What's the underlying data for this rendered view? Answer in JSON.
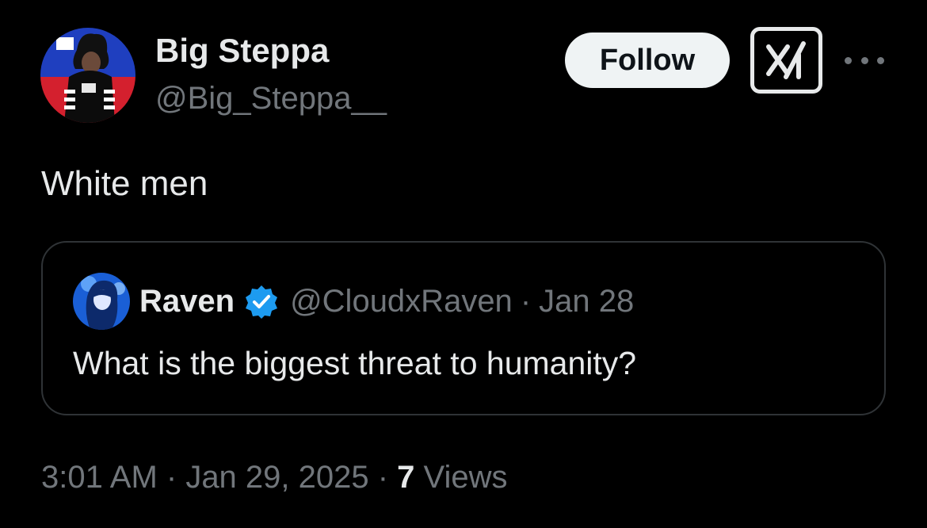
{
  "author": {
    "display_name": "Big Steppa",
    "handle": "@Big_Steppa__",
    "avatar_icon": "profile-avatar"
  },
  "actions": {
    "follow_label": "Follow",
    "grok_icon": "grok-icon",
    "more_icon": "more-horizontal-icon"
  },
  "tweet": {
    "text": "White men"
  },
  "quoted": {
    "display_name": "Raven",
    "handle": "@CloudxRaven",
    "separator": "·",
    "date": "Jan 28",
    "text": "What is the biggest threat to humanity?",
    "verified_icon": "verified-badge-icon"
  },
  "meta": {
    "time": "3:01 AM",
    "separator1": " · ",
    "date": "Jan 29, 2025",
    "separator2": " · ",
    "views_count": "7",
    "views_label": " Views"
  },
  "colors": {
    "background": "#000000",
    "primary_text": "#e7e9ea",
    "secondary_text": "#71767b",
    "border": "#2f3336",
    "verified": "#1d9bf0"
  }
}
